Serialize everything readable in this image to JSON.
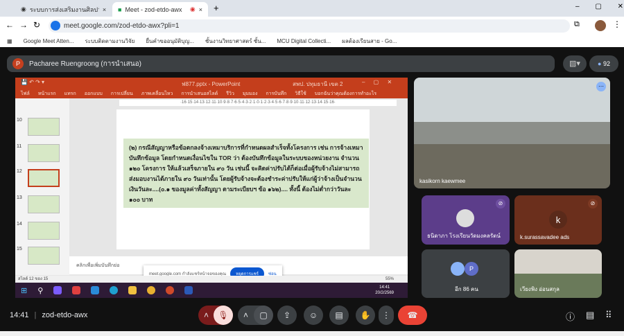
{
  "browser": {
    "tabs": [
      {
        "label": "ระบบการส่งเสริมงานศิลปวัฒนธรรม..."
      },
      {
        "label": "Meet - zod-etdo-awx"
      }
    ],
    "url": "meet.google.com/zod-etdo-awx?pli=1",
    "bookmarks": [
      "Google Meet Atten...",
      "ระบบติดตามงานวิจัย",
      "ยื่นคำขออนุมัติบุญ...",
      "ชั้นงานวิทยาศาสตร์ ชั้น...",
      "MCU Digital Collecti...",
      "ผลต้องเรียนสาย - Go..."
    ]
  },
  "presenter": {
    "initial": "P",
    "name": "Pacharee Ruengroong (การนำเสนอ)",
    "participants": "92"
  },
  "ppt": {
    "title": "ฟ877.pptx - PowerPoint",
    "user": "สพป. ปทุมธานี เขต 2",
    "ribbon": [
      "ไฟล์",
      "หน้าแรก",
      "แทรก",
      "ออกแบบ",
      "การเปลี่ยน",
      "ภาพเคลื่อนไหว",
      "การนำเสนอสไลด์",
      "รีวิว",
      "มุมมอง",
      "การบันทึก",
      "วิธีใช้",
      "บอกฉันว่าคุณต้องการทำอะไร"
    ],
    "ruler": "·16·15·14·13·12·11·10·9·8·7·6·5·4·3·2·1·0·1·2·3·4·5·6·7·8·9·10·11·12·13·14·15·16·",
    "slides": [
      "10",
      "11",
      "12",
      "13",
      "14",
      "15"
    ],
    "body": "(๒) กรณีสัญญาหรือข้อตกลงจ้างเหมาบริการที่กำหนดผลสำเร็จทั้งโครงการ เช่น การจ้างเหมาบันทึกข้อมูล โดยกำหนดเงื่อนไขใน TOR ว่า ต้องบันทึกข้อมูลในระบบของหน่วยงาน จำนวน ๑๒๐ โครงการ ให้แล้วเสร็จภายใน ๙๐ วัน เช่นนี้ จะคิดค่าปรับได้ก็ต่อเมื่อผู้รับจ้างไม่สามารถส่งมอบงานได้ภายใน ๙๐ วันเท่านั้น โดยผู้รับจ้างจะต้องชำระค่าปรับให้แก่ผู้ว่าจ้างเป็นจำนวนเงินวันละ....(๐.๑ ของมูลค่าทั้งสัญญา ตามระเบียบฯ ข้อ ๑๖๒).... ทั้งนี้ ต้องไม่ต่ำกว่าวันละ ๑๐๐ บาท",
    "notes": "คลิกเพื่อเพิ่มบันทึกย่อ",
    "status": "สไลด์ 12 ของ 15",
    "zoom": "55%",
    "popup": {
      "text": "meet.google.com กำลังแชร์หน้าจอของคุณ",
      "stop": "หยุดการแชร์",
      "hide": "ซ่อน"
    },
    "clock": "14:41",
    "date": "20/2/2569"
  },
  "tiles": {
    "main": "kasikorn kaewmee",
    "t1": "ธนิดาภา โรงเรียนวัดมงคลรัตน์",
    "t2_initial": "k",
    "t2": "k.surassavadee ads",
    "t3_initial": "P",
    "t3": "อีก 86 คน",
    "t4": "เวียงพิง อ่อนสกุล"
  },
  "bottom": {
    "time": "14:41",
    "code": "zod-etdo-awx"
  }
}
